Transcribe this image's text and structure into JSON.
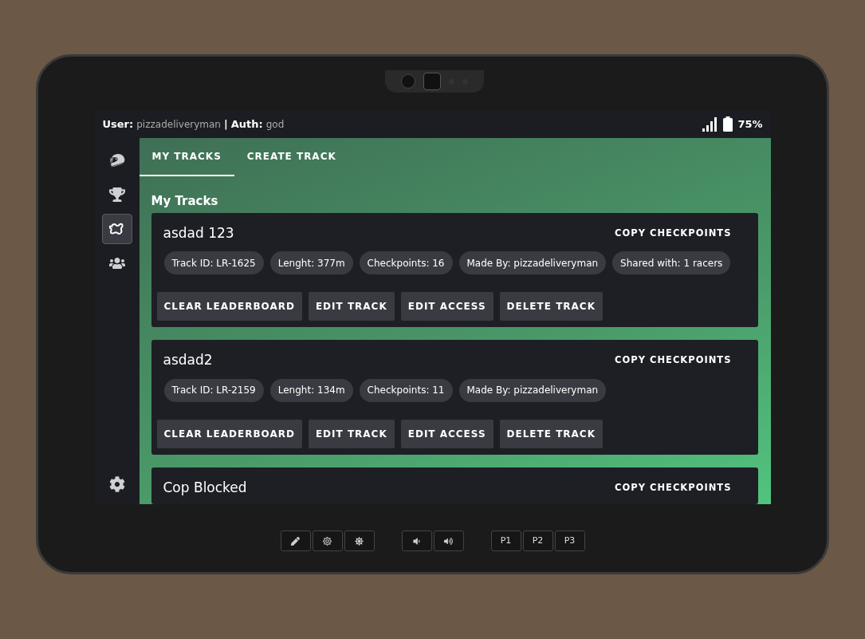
{
  "status_bar": {
    "user_label": "User:",
    "user": "pizzadeliveryman",
    "separator": "|",
    "auth_label": "Auth:",
    "auth": "god",
    "battery": "75%"
  },
  "sidebar": {
    "items": [
      {
        "kind": "helmet",
        "selected": false
      },
      {
        "kind": "trophy",
        "selected": false
      },
      {
        "kind": "track",
        "selected": true
      },
      {
        "kind": "people",
        "selected": false
      }
    ],
    "settings": {
      "kind": "gear",
      "selected": false
    }
  },
  "tabs": [
    {
      "label": "MY TRACKS",
      "selected": true
    },
    {
      "label": "CREATE TRACK",
      "selected": false
    }
  ],
  "heading": "My Tracks",
  "tracks": [
    {
      "name": "asdad 123",
      "copy": "COPY CHECKPOINTS",
      "chips": [
        "Track ID: LR-1625",
        "Lenght: 377m",
        "Checkpoints: 16",
        "Made By: pizzadeliveryman",
        "Shared with: 1 racers"
      ],
      "actions": [
        "CLEAR LEADERBOARD",
        "EDIT TRACK",
        "EDIT ACCESS",
        "DELETE TRACK"
      ]
    },
    {
      "name": "asdad2",
      "copy": "COPY CHECKPOINTS",
      "chips": [
        "Track ID: LR-2159",
        "Lenght: 134m",
        "Checkpoints: 11",
        "Made By: pizzadeliveryman"
      ],
      "actions": [
        "CLEAR LEADERBOARD",
        "EDIT TRACK",
        "EDIT ACCESS",
        "DELETE TRACK"
      ]
    },
    {
      "name": "Cop Blocked",
      "copy": "COPY CHECKPOINTS"
    }
  ],
  "hardware_buttons": [
    [
      {
        "kind": "pen"
      },
      {
        "kind": "dimmer"
      },
      {
        "kind": "brighter"
      }
    ],
    [
      {
        "kind": "quieter"
      },
      {
        "kind": "louder"
      }
    ],
    [
      {
        "kind": "text",
        "label": "P1"
      },
      {
        "kind": "text",
        "label": "P2"
      },
      {
        "kind": "text",
        "label": "P3"
      }
    ]
  ]
}
